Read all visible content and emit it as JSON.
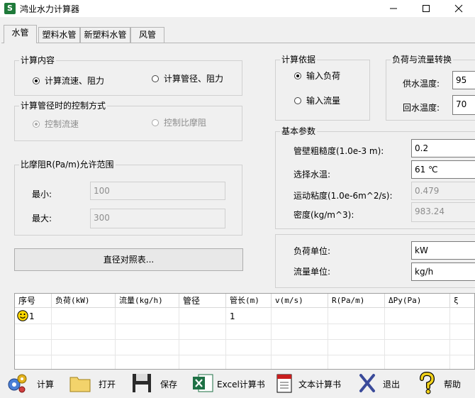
{
  "window": {
    "title": "鸿业水力计算器",
    "icon": "app-logo-icon",
    "controls": [
      "minimize-icon",
      "maximize-icon",
      "close-icon"
    ]
  },
  "tabs": [
    {
      "label": "水管",
      "active": true
    },
    {
      "label": "塑料水管"
    },
    {
      "label": "新塑料水管"
    },
    {
      "label": "风管"
    }
  ],
  "calc_content": {
    "title": "计算内容",
    "option1": {
      "label": "计算流速、阻力",
      "checked": true
    },
    "option2": {
      "label": "计算管径、阻力",
      "checked": false
    }
  },
  "diameter_control": {
    "title": "计算管径时的控制方式",
    "option1": {
      "label": "控制流速",
      "checked": true,
      "disabled": true
    },
    "option2": {
      "label": "控制比摩阻",
      "checked": false,
      "disabled": true
    }
  },
  "friction_range": {
    "title": "比摩阻R(Pa/m)允许范围",
    "min_label": "最小:",
    "min_value": "100",
    "max_label": "最大:",
    "max_value": "300"
  },
  "diameter_table_button": "直径对照表...",
  "calc_basis": {
    "title": "计算依据",
    "option1": {
      "label": "输入负荷",
      "checked": true
    },
    "option2": {
      "label": "输入流量",
      "checked": false
    }
  },
  "load_flow": {
    "title": "负荷与流量转换",
    "supply_label": "供水温度:",
    "supply_value": "95",
    "return_label": "回水温度:",
    "return_value": "70"
  },
  "basic_params": {
    "title": "基本参数",
    "roughness_label": "管壁粗糙度(1.0e-3 m):",
    "roughness_value": "0.2",
    "water_temp_label": "选择水温:",
    "water_temp_value": "61 ℃",
    "viscosity_label": "运动粘度(1.0e-6m^2/s):",
    "viscosity_value": "0.479",
    "density_label": "密度(kg/m^3):",
    "density_value": "983.24"
  },
  "units": {
    "load_label": "负荷单位:",
    "load_value": "kW",
    "flow_label": "流量单位:",
    "flow_value": "kg/h"
  },
  "grid": {
    "headers": [
      "序号",
      "负荷(kW)",
      "流量(kg/h)",
      "管径",
      "管长(m)",
      "v(m/s)",
      "R(Pa/m)",
      "ΔPy(Pa)",
      "ξ"
    ],
    "rows": [
      {
        "index": "1",
        "length": "1",
        "status_icon": "smiley-icon"
      }
    ]
  },
  "toolbar": [
    {
      "label": "计算",
      "icon": "gears-icon"
    },
    {
      "label": "打开",
      "icon": "folder-icon"
    },
    {
      "label": "保存",
      "icon": "floppy-disk-icon"
    },
    {
      "label": "Excel计算书",
      "icon": "excel-icon"
    },
    {
      "label": "文本计算书",
      "icon": "notebook-icon"
    },
    {
      "label": "退出",
      "icon": "exit-x-icon"
    },
    {
      "label": "帮助",
      "icon": "help-question-icon"
    }
  ]
}
